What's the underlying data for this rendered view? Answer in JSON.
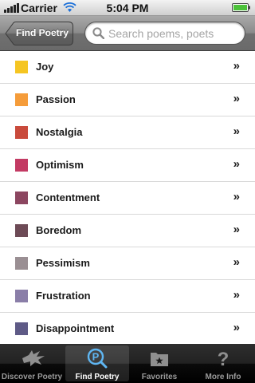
{
  "status_bar": {
    "carrier": "Carrier",
    "time": "5:04 PM"
  },
  "nav": {
    "back_label": "Find Poetry",
    "search_placeholder": "Search poems, poets"
  },
  "moods": [
    {
      "label": "Joy",
      "color": "#f5c522"
    },
    {
      "label": "Passion",
      "color": "#f59c3a"
    },
    {
      "label": "Nostalgia",
      "color": "#c94a3c"
    },
    {
      "label": "Optimism",
      "color": "#c33a63"
    },
    {
      "label": "Contentment",
      "color": "#8c4660"
    },
    {
      "label": "Boredom",
      "color": "#6d4a56"
    },
    {
      "label": "Pessimism",
      "color": "#9a8f93"
    },
    {
      "label": "Frustration",
      "color": "#8a7ea8"
    },
    {
      "label": "Disappointment",
      "color": "#5e5a86"
    }
  ],
  "row_chevron": "»",
  "tabs": [
    {
      "label": "Discover Poetry",
      "icon": "pegasus-icon",
      "active": false
    },
    {
      "label": "Find Poetry",
      "icon": "magnifier-p-icon",
      "active": true
    },
    {
      "label": "Favorites",
      "icon": "folder-star-icon",
      "active": false
    },
    {
      "label": "More Info",
      "icon": "question-mark-icon",
      "active": false
    }
  ]
}
